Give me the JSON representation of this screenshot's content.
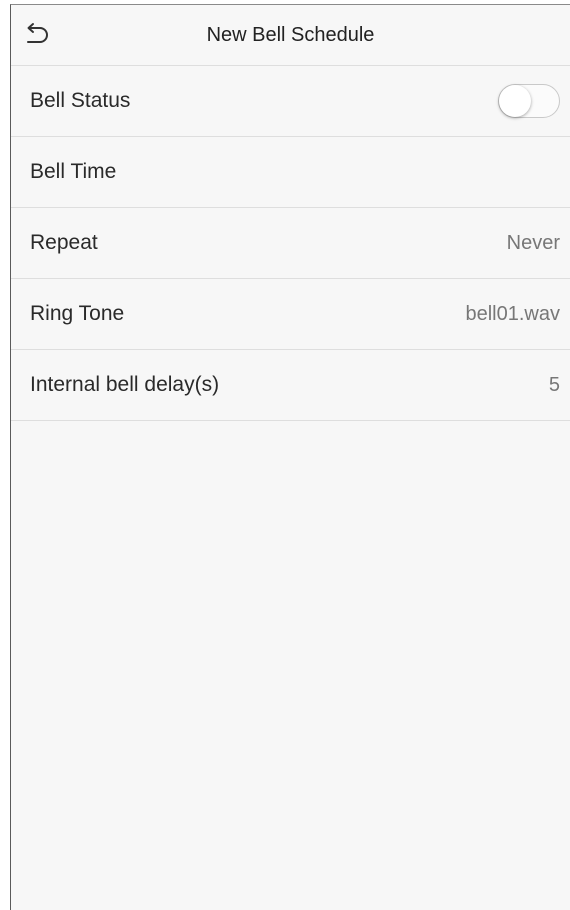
{
  "header": {
    "back_icon": "back-arrow-icon",
    "title": "New Bell Schedule"
  },
  "settings": {
    "bell_status": {
      "label": "Bell Status",
      "enabled": false
    },
    "bell_time": {
      "label": "Bell Time",
      "value": ""
    },
    "repeat": {
      "label": "Repeat",
      "value": "Never"
    },
    "ring_tone": {
      "label": "Ring Tone",
      "value": "bell01.wav"
    },
    "internal_bell_delay": {
      "label": "Internal bell delay(s)",
      "value": "5"
    }
  }
}
